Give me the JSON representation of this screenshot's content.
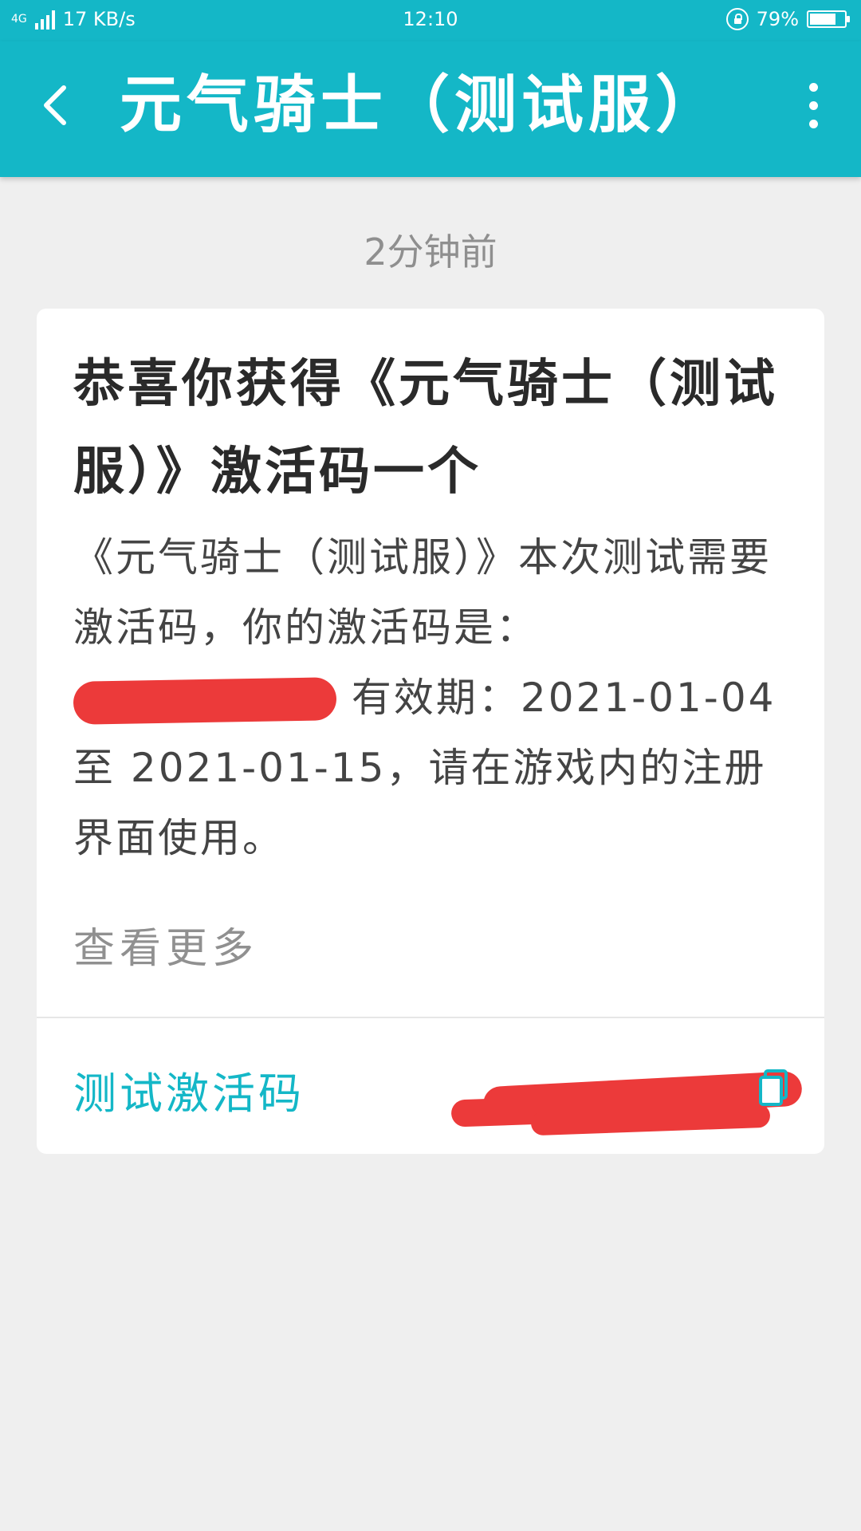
{
  "status_bar": {
    "network_type": "4G",
    "speed": "17 KB/s",
    "time": "12:10",
    "battery_percent": 79,
    "battery_label": "79%"
  },
  "app_bar": {
    "title": "元气骑士（测试服）"
  },
  "message": {
    "timestamp": "2分钟前",
    "title": "恭喜你获得《元气骑士（测试服）》激活码一个",
    "body_part1": "《元气骑士（测试服）》本次测试需要激活码，你的激活码是：",
    "body_part2": " 有效期：2021-01-04 至 2021-01-15，请在游戏内的注册界面使用。",
    "view_more": "查看更多",
    "code_label": "测试激活码"
  },
  "colors": {
    "accent": "#14b7c7",
    "background": "#efefef",
    "redaction": "#ec3a3a"
  },
  "icons": {
    "back": "back-arrow-icon",
    "more": "more-vertical-icon",
    "copy": "copy-icon",
    "lock": "rotation-lock-icon"
  }
}
